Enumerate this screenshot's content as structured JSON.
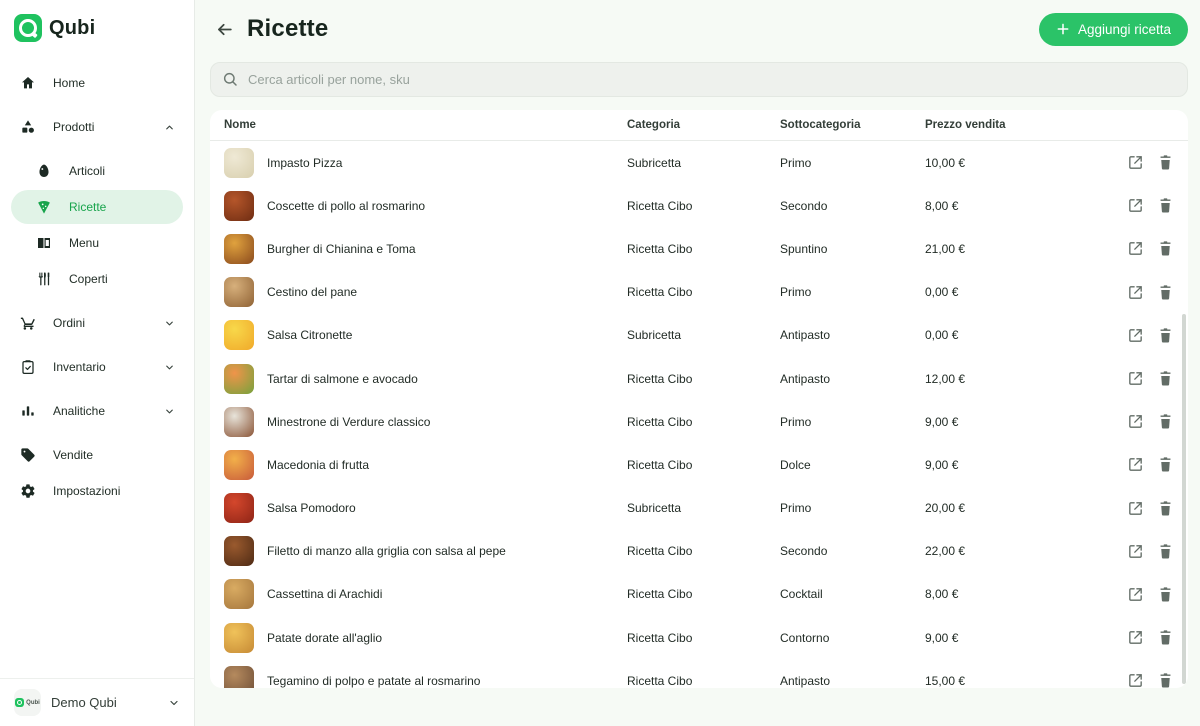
{
  "brand": {
    "name": "Qubi",
    "accent_green": "#2bc368",
    "active_bg": "#e1f3e7",
    "active_text": "#18a44c"
  },
  "sidebar": {
    "items": [
      {
        "label": "Home",
        "icon": "home-icon",
        "sub": false,
        "chevron": null,
        "active": false,
        "gap": false
      },
      {
        "label": "Prodotti",
        "icon": "products-icon",
        "sub": false,
        "chevron": "up",
        "active": false,
        "gap": true
      },
      {
        "label": "Articoli",
        "icon": "egg-icon",
        "sub": true,
        "chevron": null,
        "active": false,
        "gap": true
      },
      {
        "label": "Ricette",
        "icon": "pizza-icon",
        "sub": true,
        "chevron": null,
        "active": true,
        "gap": false
      },
      {
        "label": "Menu",
        "icon": "menu-book-icon",
        "sub": true,
        "chevron": null,
        "active": false,
        "gap": false
      },
      {
        "label": "Coperti",
        "icon": "cutlery-icon",
        "sub": true,
        "chevron": null,
        "active": false,
        "gap": false
      },
      {
        "label": "Ordini",
        "icon": "cart-icon",
        "sub": false,
        "chevron": "down",
        "active": false,
        "gap": true
      },
      {
        "label": "Inventario",
        "icon": "clipboard-icon",
        "sub": false,
        "chevron": "down",
        "active": false,
        "gap": true
      },
      {
        "label": "Analitiche",
        "icon": "chart-icon",
        "sub": false,
        "chevron": "down",
        "active": false,
        "gap": true
      },
      {
        "label": "Vendite",
        "icon": "tag-icon",
        "sub": false,
        "chevron": null,
        "active": false,
        "gap": true
      },
      {
        "label": "Impostazioni",
        "icon": "gear-icon",
        "sub": false,
        "chevron": null,
        "active": false,
        "gap": false
      }
    ],
    "footer": {
      "workspace": "Demo Qubi",
      "mini_word": "Qubi"
    }
  },
  "header": {
    "title": "Ricette",
    "add_button_label": "Aggiungi ricetta"
  },
  "search": {
    "placeholder": "Cerca articoli per nome, sku"
  },
  "table": {
    "columns": [
      "Nome",
      "Categoria",
      "Sottocategoria",
      "Prezzo vendita"
    ],
    "rows": [
      {
        "name": "Impasto Pizza",
        "category": "Subricetta",
        "subcategory": "Primo",
        "price": "10,00 €",
        "thumb": [
          "#efe9d5",
          "#d8cfae"
        ]
      },
      {
        "name": "Coscette di pollo al rosmarino",
        "category": "Ricetta Cibo",
        "subcategory": "Secondo",
        "price": "8,00 €",
        "thumb": [
          "#b5562a",
          "#6e2c12"
        ]
      },
      {
        "name": "Burgher di Chianina e Toma",
        "category": "Ricetta Cibo",
        "subcategory": "Spuntino",
        "price": "21,00 €",
        "thumb": [
          "#e0a23e",
          "#8a4a1d"
        ]
      },
      {
        "name": "Cestino del pane",
        "category": "Ricetta Cibo",
        "subcategory": "Primo",
        "price": "0,00 €",
        "thumb": [
          "#d7b07c",
          "#8f6234"
        ]
      },
      {
        "name": "Salsa Citronette",
        "category": "Subricetta",
        "subcategory": "Antipasto",
        "price": "0,00 €",
        "thumb": [
          "#f8d84a",
          "#f0a92a"
        ]
      },
      {
        "name": "Tartar di salmone e avocado",
        "category": "Ricetta Cibo",
        "subcategory": "Antipasto",
        "price": "12,00 €",
        "thumb": [
          "#f0944a",
          "#76a23c"
        ]
      },
      {
        "name": "Minestrone di Verdure classico",
        "category": "Ricetta Cibo",
        "subcategory": "Primo",
        "price": "9,00 €",
        "thumb": [
          "#e8e4da",
          "#8a5436"
        ]
      },
      {
        "name": "Macedonia di frutta",
        "category": "Ricetta Cibo",
        "subcategory": "Dolce",
        "price": "9,00 €",
        "thumb": [
          "#f2b04a",
          "#c85a3a"
        ]
      },
      {
        "name": "Salsa Pomodoro",
        "category": "Subricetta",
        "subcategory": "Primo",
        "price": "20,00 €",
        "thumb": [
          "#d4472c",
          "#8e2416"
        ]
      },
      {
        "name": "Filetto di manzo alla griglia con salsa al pepe",
        "category": "Ricetta Cibo",
        "subcategory": "Secondo",
        "price": "22,00 €",
        "thumb": [
          "#9a5a2e",
          "#4e2a14"
        ]
      },
      {
        "name": "Cassettina di Arachidi",
        "category": "Ricetta Cibo",
        "subcategory": "Cocktail",
        "price": "8,00 €",
        "thumb": [
          "#d9ab62",
          "#a5763c"
        ]
      },
      {
        "name": "Patate dorate all'aglio",
        "category": "Ricetta Cibo",
        "subcategory": "Contorno",
        "price": "9,00 €",
        "thumb": [
          "#f0c25a",
          "#c68a35"
        ]
      },
      {
        "name": "Tegamino di polpo e patate al rosmarino",
        "category": "Ricetta Cibo",
        "subcategory": "Antipasto",
        "price": "15,00 €",
        "thumb": [
          "#b58a5e",
          "#6e4e36"
        ]
      }
    ]
  }
}
